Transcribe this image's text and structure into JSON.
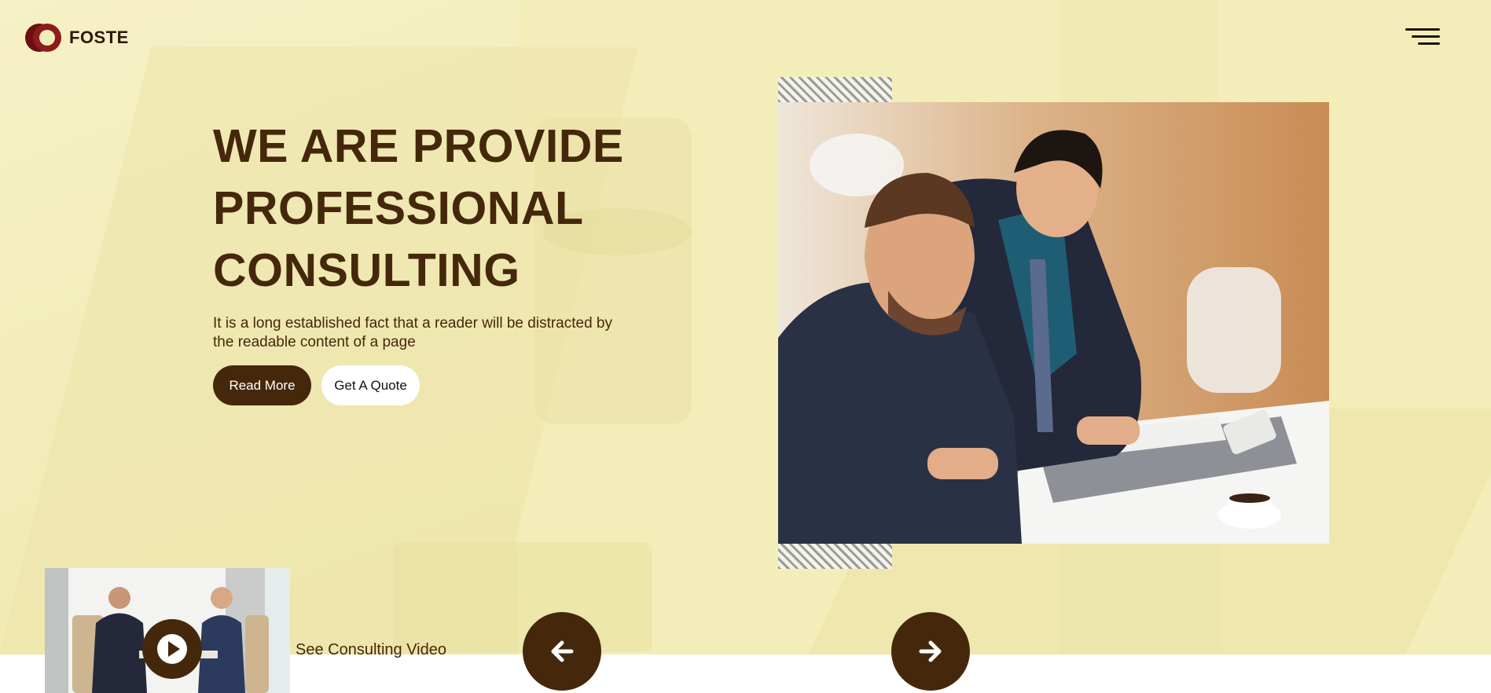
{
  "brand": {
    "name": "FOSTE",
    "logo_icon": "double-ring-logo-icon",
    "colors": {
      "primary": "#45280b",
      "logo": "#6b0f12",
      "background": "#f3eeb9"
    }
  },
  "header": {
    "menu_icon": "hamburger-menu-icon"
  },
  "hero": {
    "headline_lines": [
      "WE ARE PROVIDE",
      "PROFESSIONAL",
      "CONSULTING"
    ],
    "description_lines": [
      "It is a long established fact that a reader will be distracted by",
      "the readable content of a page"
    ],
    "read_more_label": "Read More",
    "quote_label": "Get A Quote"
  },
  "video": {
    "label": "See Consulting Video",
    "play_icon": "play-icon"
  },
  "slider": {
    "prev_icon": "arrow-left-icon",
    "next_icon": "arrow-right-icon"
  }
}
